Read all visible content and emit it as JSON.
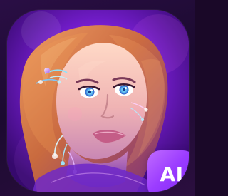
{
  "badge": {
    "label": "AI"
  },
  "colors": {
    "background": "#1a0828",
    "tile_primary": "#7a1fd6",
    "tile_glow": "#b23cff",
    "badge_primary": "#9b3cff",
    "eye_glow": "#59d8ff",
    "hair": "#d97a49"
  },
  "icons": {
    "main_artwork": "portrait-icon",
    "badge": "ai-badge"
  }
}
